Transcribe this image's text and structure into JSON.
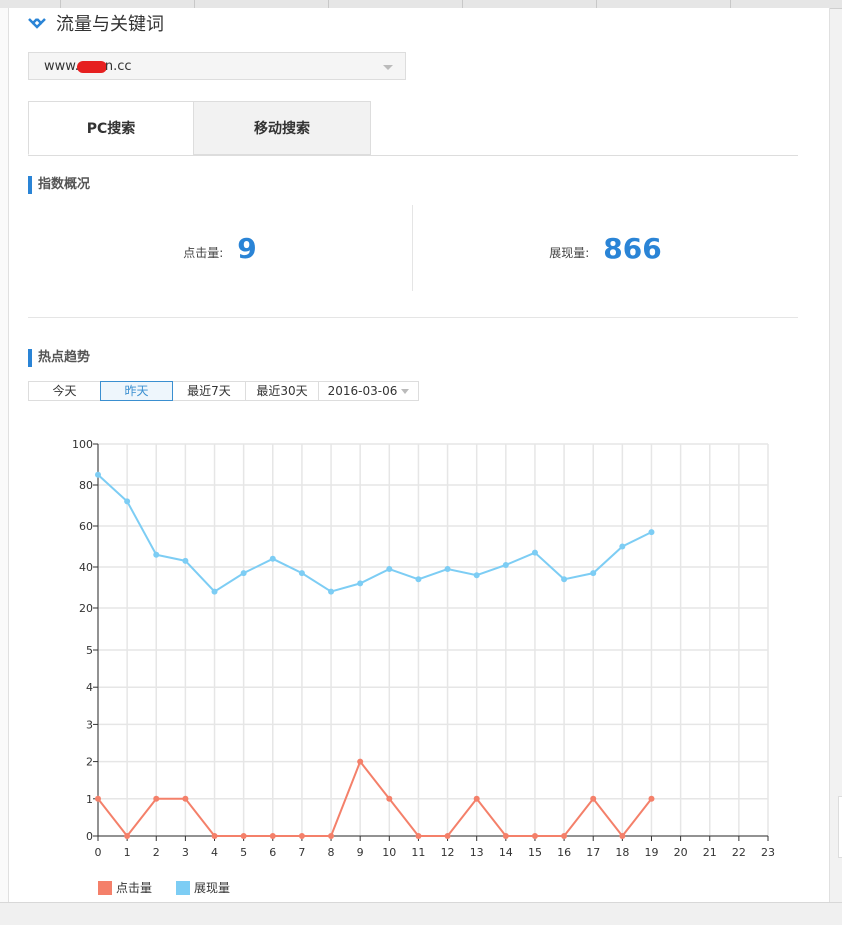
{
  "page": {
    "title": "流量与关键词",
    "accent_color": "#2a84d6"
  },
  "domain_select": {
    "value_prefix": "www.",
    "value_suffix": "n.cc"
  },
  "search_tabs": [
    {
      "label": "PC搜索",
      "active": true
    },
    {
      "label": "移动搜索",
      "active": false
    }
  ],
  "overview": {
    "heading": "指数概况",
    "clicks_label": "点击量:",
    "clicks_value": "9",
    "impressions_label": "展现量:",
    "impressions_value": "866"
  },
  "trend": {
    "heading": "热点趋势",
    "range_options": [
      {
        "label": "今天",
        "selected": false
      },
      {
        "label": "昨天",
        "selected": true
      },
      {
        "label": "最近7天",
        "selected": false
      },
      {
        "label": "最近30天",
        "selected": false
      }
    ],
    "date_value": "2016-03-06"
  },
  "chart_data": {
    "type": "line",
    "x": [
      0,
      1,
      2,
      3,
      4,
      5,
      6,
      7,
      8,
      9,
      10,
      11,
      12,
      13,
      14,
      15,
      16,
      17,
      18,
      19,
      20,
      21,
      22,
      23
    ],
    "x_ticks": [
      "0",
      "1",
      "2",
      "3",
      "4",
      "5",
      "6",
      "7",
      "8",
      "9",
      "10",
      "11",
      "12",
      "13",
      "14",
      "15",
      "16",
      "17",
      "18",
      "19",
      "20",
      "21",
      "22",
      "23"
    ],
    "upper_axis": {
      "ticks": [
        "20",
        "40",
        "60",
        "80",
        "100"
      ],
      "range": [
        20,
        100
      ]
    },
    "lower_axis": {
      "ticks": [
        "0",
        "1",
        "2",
        "3",
        "4",
        "5"
      ],
      "range": [
        0,
        5
      ]
    },
    "grid": true,
    "legend_position": "bottom-left",
    "series": [
      {
        "name": "点击量",
        "color": "#f4806a",
        "axis": "lower",
        "values": [
          1,
          0,
          1,
          1,
          0,
          0,
          0,
          0,
          0,
          2,
          1,
          0,
          0,
          1,
          0,
          0,
          0,
          1,
          0,
          1
        ]
      },
      {
        "name": "展现量",
        "color": "#7dcdf4",
        "axis": "upper",
        "values": [
          85,
          72,
          46,
          43,
          28,
          37,
          44,
          37,
          28,
          32,
          39,
          34,
          39,
          36,
          41,
          47,
          34,
          37,
          50,
          57
        ]
      }
    ]
  }
}
